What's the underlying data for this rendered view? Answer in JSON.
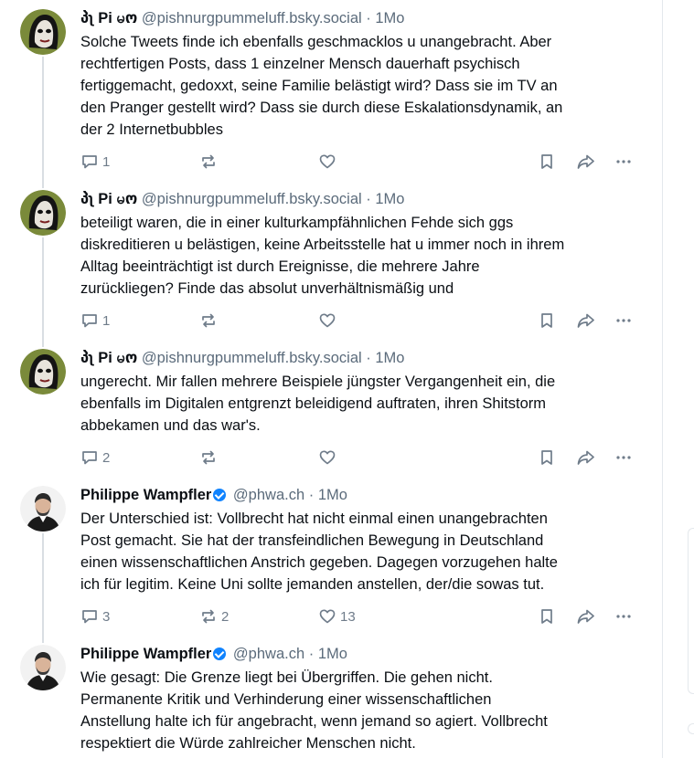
{
  "posts": [
    {
      "name": "პʅ Pi မო",
      "handle": "@pishnurgpummeluff.bsky.social",
      "time": "· 1Mo",
      "verified": false,
      "avatar": "pi",
      "lines": [
        "Solche Tweets finde ich ebenfalls geschmacklos u unangebracht. Aber",
        "rechtfertigen Posts, dass 1 einzelner Mensch dauerhaft psychisch",
        "fertiggemacht, gedoxxt, seine Familie belästigt wird? Dass sie im TV an",
        "den Pranger gestellt wird? Dass sie durch diese Eskalationsdynamik, an",
        "der 2 Internetbubbles"
      ],
      "replies": "1",
      "reposts": "",
      "likes": ""
    },
    {
      "name": "პʅ Pi မო",
      "handle": "@pishnurgpummeluff.bsky.social",
      "time": "· 1Mo",
      "verified": false,
      "avatar": "pi",
      "lines": [
        "beteiligt waren, die in einer kulturkampfähnlichen Fehde sich ggs",
        "diskreditieren u belästigen, keine Arbeitsstelle hat u immer noch in ihrem",
        "Alltag beeinträchtigt ist durch Ereignisse, die mehrere Jahre",
        "zurückliegen? Finde das absolut unverhältnismäßig und"
      ],
      "replies": "1",
      "reposts": "",
      "likes": ""
    },
    {
      "name": "პʅ Pi မო",
      "handle": "@pishnurgpummeluff.bsky.social",
      "time": "· 1Mo",
      "verified": false,
      "avatar": "pi",
      "lines": [
        "ungerecht. Mir fallen mehrere Beispiele jüngster Vergangenheit ein, die",
        "ebenfalls im Digitalen entgrenzt beleidigend auftraten, ihren Shitstorm",
        "abbekamen und das war's."
      ],
      "replies": "2",
      "reposts": "",
      "likes": ""
    },
    {
      "name": "Philippe Wampfler",
      "handle": "@phwa.ch",
      "time": "· 1Mo",
      "verified": true,
      "avatar": "phil",
      "lines": [
        "Der Unterschied ist: Vollbrecht hat nicht einmal einen unangebrachten",
        "Post gemacht. Sie hat der transfeindlichen Bewegung in Deutschland",
        "einen wissenschaftlichen Anstrich gegeben. Dagegen vorzugehen halte",
        "ich für legitim. Keine Uni sollte jemanden anstellen, der/die sowas tut."
      ],
      "replies": "3",
      "reposts": "2",
      "likes": "13"
    },
    {
      "name": "Philippe Wampfler",
      "handle": "@phwa.ch",
      "time": "· 1Mo",
      "verified": true,
      "avatar": "phil",
      "lines": [
        "Wie gesagt: Die Grenze liegt bei Übergriffen. Die gehen nicht.",
        "Permanente Kritik und Verhinderung einer wissenschaftlichen",
        "Anstellung halte ich für angebracht, wenn jemand so agiert. Vollbrecht",
        "respektiert die Würde zahlreicher Menschen nicht."
      ],
      "replies": "",
      "reposts": "",
      "likes": ""
    }
  ],
  "colors": {
    "accent": "#1083fe",
    "muted": "#6f7c8a",
    "thread_line": "#d9dee3"
  }
}
